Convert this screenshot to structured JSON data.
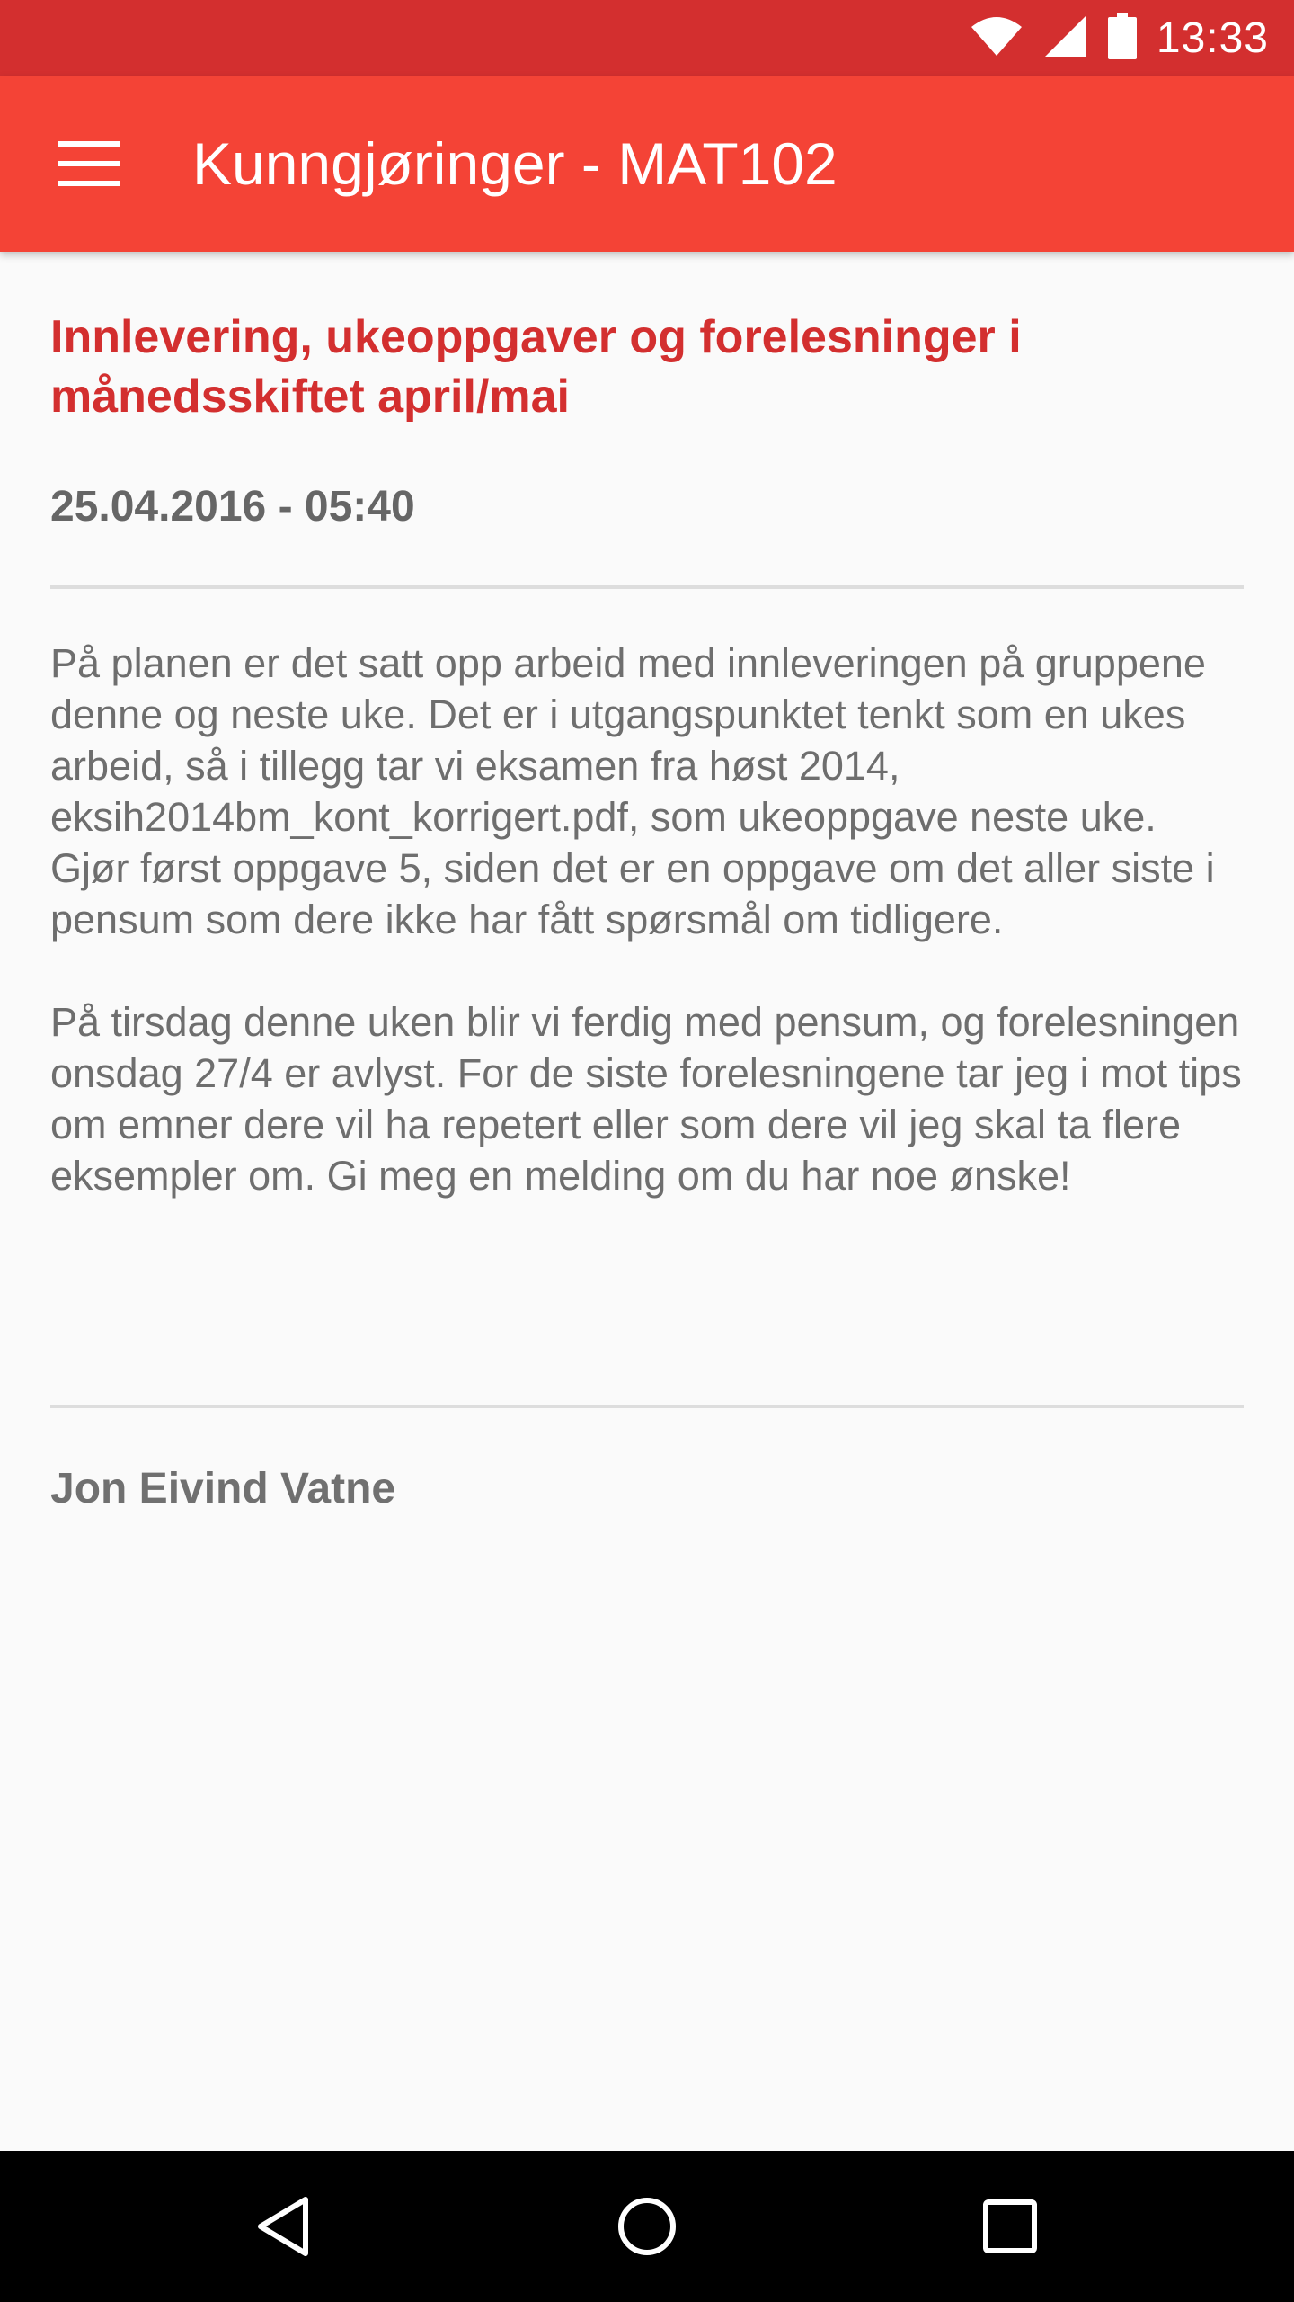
{
  "status_bar": {
    "time": "13:33",
    "icons": [
      "wifi-icon",
      "cell-signal-icon",
      "battery-icon"
    ],
    "background_color": "#d32f2f"
  },
  "app_bar": {
    "title": "Kunngjøringer - MAT102",
    "menu_icon": "hamburger-menu-icon",
    "background_color": "#f44336"
  },
  "announcement": {
    "title": "Innlevering, ukeoppgaver og forelesninger i månedsskiftet april/mai",
    "date": "25.04.2016 - 05:40",
    "paragraphs": [
      "På planen er det satt opp arbeid med innleveringen på gruppene denne og neste uke. Det er i utgangspunktet tenkt som en ukes arbeid, så i tillegg tar vi eksamen fra høst 2014, eksih2014bm_kont_korrigert.pdf, som ukeoppgave neste uke. Gjør først oppgave 5, siden det er en oppgave om det aller siste i pensum som dere ikke har fått spørsmål om tidligere.",
      "På tirsdag denne uken blir vi ferdig med pensum, og forelesningen onsdag 27/4 er avlyst. For de siste forelesningene tar jeg i mot tips om emner dere vil ha repetert eller som dere vil jeg skal ta flere eksempler om. Gi meg en melding om du har noe ønske!"
    ],
    "author": "Jon Eivind Vatne",
    "title_color": "#d32f2f"
  },
  "nav_bar": {
    "buttons": [
      "back-icon",
      "home-icon",
      "recents-icon"
    ]
  }
}
